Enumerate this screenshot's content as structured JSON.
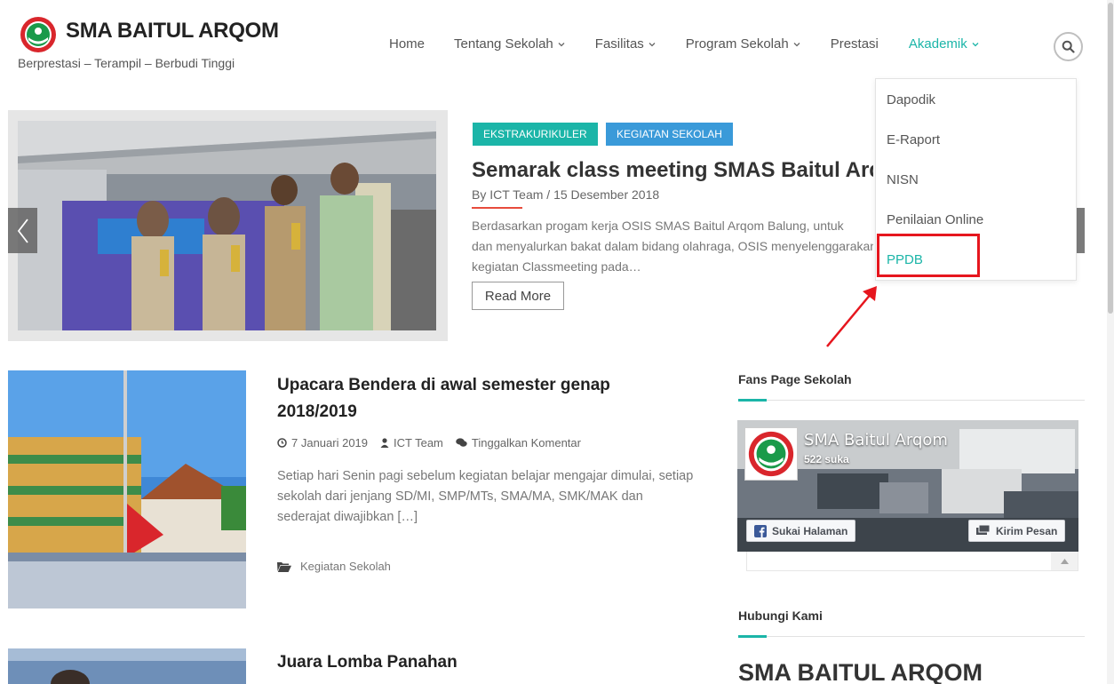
{
  "site": {
    "title": "SMA BAITUL ARQOM",
    "tagline": "Berprestasi – Terampil – Berbudi Tinggi"
  },
  "nav": {
    "items": [
      {
        "label": "Home",
        "has_dropdown": false
      },
      {
        "label": "Tentang Sekolah",
        "has_dropdown": true
      },
      {
        "label": "Fasilitas",
        "has_dropdown": true
      },
      {
        "label": "Program Sekolah",
        "has_dropdown": true
      },
      {
        "label": "Prestasi",
        "has_dropdown": false
      },
      {
        "label": "Akademik",
        "has_dropdown": true,
        "active": true
      }
    ],
    "accent_color": "#1bb5a8"
  },
  "dropdown": {
    "items": [
      "Dapodik",
      "E-Raport",
      "NISN",
      "Penilaian Online",
      "PPDB"
    ],
    "highlighted": "PPDB"
  },
  "slider": {
    "tags": [
      "EKSTRAKURIKULER",
      "KEGIATAN SEKOLAH"
    ],
    "title": "Semarak class meeting SMAS Baitul Arqom",
    "meta": "By ICT Team  /  15 Desember 2018",
    "excerpt_lines": [
      "Berdasarkan progam kerja OSIS SMAS Baitul Arqom Balung, untuk",
      "dan menyalurkan bakat dalam bidang olahraga, OSIS menyelenggarakan",
      "kegiatan Classmeeting pada…"
    ],
    "read_more": "Read More"
  },
  "posts": [
    {
      "title_lines": [
        "Upacara Bendera di awal semester genap",
        "2018/2019"
      ],
      "date": "7 Januari 2019",
      "author": "ICT Team",
      "comments": "Tinggalkan Komentar",
      "excerpt": "Setiap hari Senin pagi sebelum kegiatan belajar mengajar dimulai, setiap sekolah dari jenjang SD/MI, SMP/MTs, SMA/MA, SMK/MAK dan sederajat diwajibkan […]",
      "category": "Kegiatan Sekolah"
    },
    {
      "title_lines": [
        "Juara Lomba Panahan"
      ]
    }
  ],
  "sidebar": {
    "fanspage_title": "Fans Page Sekolah",
    "fb": {
      "page_name": "SMA Baitul Arqom",
      "likes": "522 suka",
      "like_button": "Sukai Halaman",
      "message_button": "Kirim Pesan"
    },
    "contact_title": "Hubungi Kami",
    "contact_heading": "SMA BAITUL ARQOM"
  },
  "colors": {
    "teal": "#1bb5a8",
    "blue_tag": "#3a9ad9",
    "highlight_red": "#e6161e"
  }
}
